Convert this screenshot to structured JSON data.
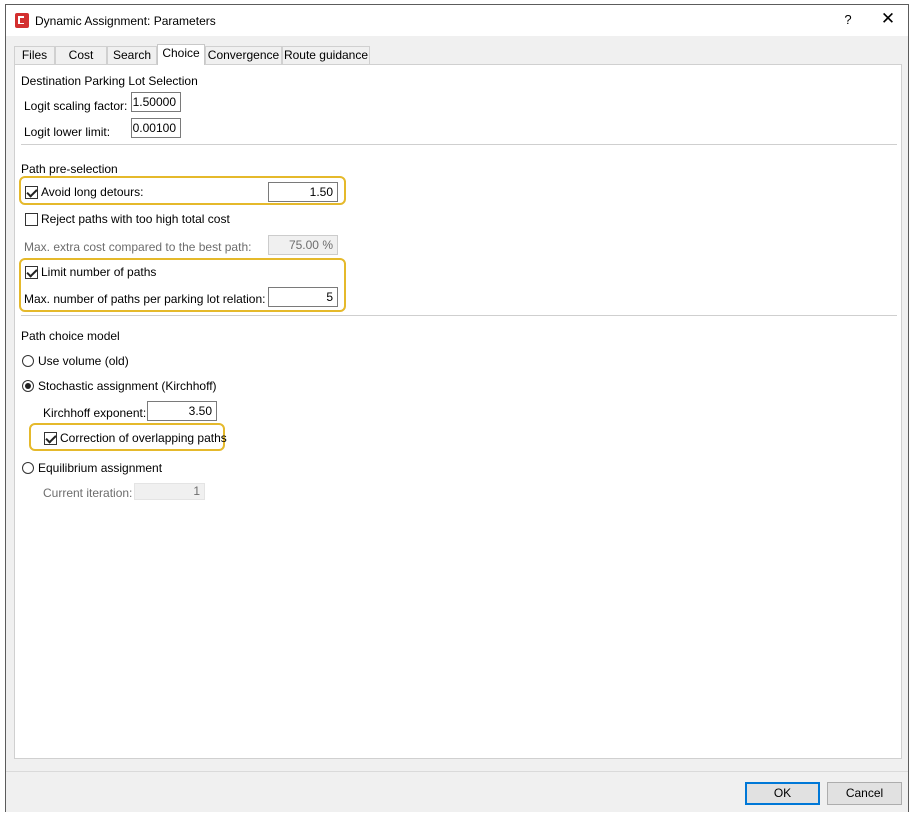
{
  "window": {
    "title": "Dynamic Assignment: Parameters",
    "help_label": "?",
    "close_label": "✕"
  },
  "tabs": [
    {
      "label": "Files"
    },
    {
      "label": "Cost"
    },
    {
      "label": "Search"
    },
    {
      "label": "Choice"
    },
    {
      "label": "Convergence"
    },
    {
      "label": "Route guidance"
    }
  ],
  "active_tab": "Choice",
  "destination": {
    "heading": "Destination Parking Lot Selection",
    "logit_scaling_label": "Logit scaling factor:",
    "logit_scaling_value": "1.50000",
    "logit_lower_label": "Logit lower limit:",
    "logit_lower_value": "0.00100"
  },
  "preselection": {
    "heading": "Path pre-selection",
    "avoid_detours_label": "Avoid long detours:",
    "avoid_detours_checked": true,
    "avoid_detours_value": "1.50",
    "reject_paths_label": "Reject paths with too high total cost",
    "reject_paths_checked": false,
    "max_extra_cost_label": "Max. extra cost compared to the best path:",
    "max_extra_cost_value": "75.00 %",
    "limit_paths_label": "Limit number of paths",
    "limit_paths_checked": true,
    "max_paths_label": "Max. number of paths per parking lot relation:",
    "max_paths_value": "5"
  },
  "choice_model": {
    "heading": "Path choice model",
    "use_volume_label": "Use volume (old)",
    "stochastic_label": "Stochastic assignment (Kirchhoff)",
    "selected": "stochastic",
    "kirchhoff_label": "Kirchhoff exponent:",
    "kirchhoff_value": "3.50",
    "correction_label": "Correction of overlapping paths",
    "correction_checked": true,
    "equilibrium_label": "Equilibrium assignment",
    "current_iteration_label": "Current iteration:",
    "current_iteration_value": "1"
  },
  "buttons": {
    "ok_label": "OK",
    "cancel_label": "Cancel"
  },
  "colors": {
    "highlight": "#e5b92b",
    "default_button_border": "#0078d7",
    "app_icon": "#d32f2f"
  }
}
